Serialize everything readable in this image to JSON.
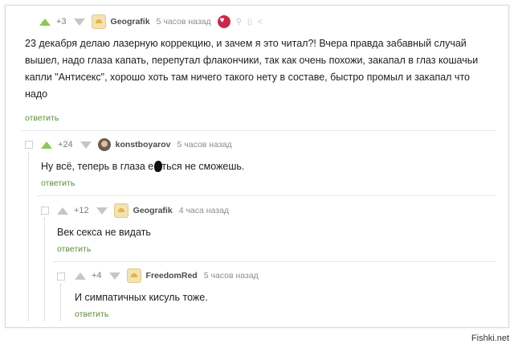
{
  "comments": [
    {
      "score": "+3",
      "user": "Geografik",
      "time": "5 часов назад",
      "text_lines": [
        "23 декабря делаю лазерную коррекцию, и зачем я это читал?! Вчера правда забавный случай",
        "вышел, надо глаза капать, перепутал флакончики, так как очень похожи, закапал в глаз кошачьи",
        "капли \"Антисекс\", хорошо хоть там ничего такого нету в составе, быстро промыл и закапал что",
        "надо"
      ],
      "reply_label": "ответить"
    },
    {
      "score": "+24",
      "user": "konstboyarov",
      "time": "5 часов назад",
      "text_lines": [
        "Ну всё, теперь в глаза е  аться не сможешь."
      ],
      "reply_label": "ответить"
    },
    {
      "score": "+12",
      "user": "Geografik",
      "time": "4 часа назад",
      "text_lines": [
        "Век секса не видать"
      ],
      "reply_label": "ответить"
    },
    {
      "score": "+4",
      "user": "FreedomRed",
      "time": "5 часов назад",
      "text_lines": [
        "И симпатичных кисуль тоже."
      ],
      "reply_label": "ответить"
    }
  ],
  "watermark": "Fishki.net",
  "colors": {
    "upvote": "#8ac858",
    "reply_link": "#5a8f3c",
    "badge": "#c8284c"
  },
  "icons": [
    "upvote-icon",
    "downvote-icon",
    "avatar",
    "heart-badge-icon",
    "link-icon",
    "save-icon",
    "share-icon",
    "collapse-icon"
  ]
}
